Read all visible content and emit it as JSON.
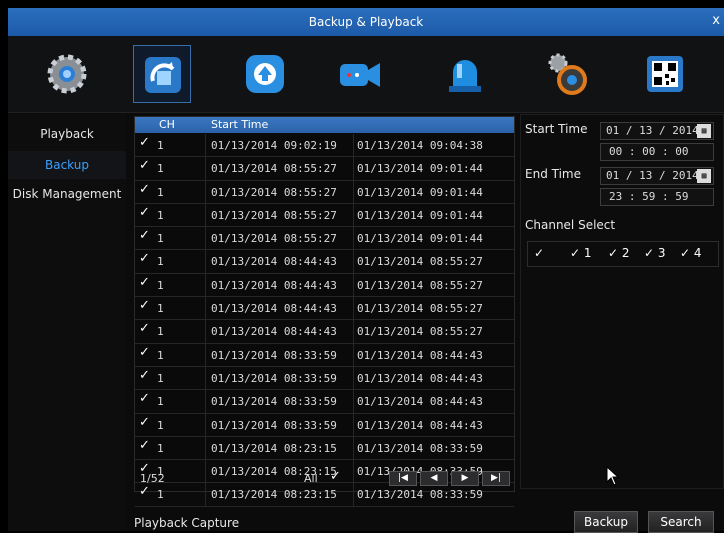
{
  "window": {
    "title": "Backup & Playback",
    "close_glyph": "x"
  },
  "toolbar": {
    "items": [
      {
        "icon": "gear-icon"
      },
      {
        "icon": "backup-icon"
      },
      {
        "icon": "upload-icon"
      },
      {
        "icon": "camera-icon"
      },
      {
        "icon": "alarm-icon"
      },
      {
        "icon": "settings-icon"
      },
      {
        "icon": "qr-code-icon"
      }
    ]
  },
  "nav": {
    "items": [
      {
        "label": "Playback"
      },
      {
        "label": "Backup"
      },
      {
        "label": "Disk Management"
      }
    ]
  },
  "table": {
    "headers": {
      "ch": "CH",
      "start": "Start Time",
      "end": ""
    },
    "rows": [
      {
        "ch": "1",
        "start": "01/13/2014 09:02:19",
        "end": "01/13/2014 09:04:38"
      },
      {
        "ch": "1",
        "start": "01/13/2014 08:55:27",
        "end": "01/13/2014 09:01:44"
      },
      {
        "ch": "1",
        "start": "01/13/2014 08:55:27",
        "end": "01/13/2014 09:01:44"
      },
      {
        "ch": "1",
        "start": "01/13/2014 08:55:27",
        "end": "01/13/2014 09:01:44"
      },
      {
        "ch": "1",
        "start": "01/13/2014 08:55:27",
        "end": "01/13/2014 09:01:44"
      },
      {
        "ch": "1",
        "start": "01/13/2014 08:44:43",
        "end": "01/13/2014 08:55:27"
      },
      {
        "ch": "1",
        "start": "01/13/2014 08:44:43",
        "end": "01/13/2014 08:55:27"
      },
      {
        "ch": "1",
        "start": "01/13/2014 08:44:43",
        "end": "01/13/2014 08:55:27"
      },
      {
        "ch": "1",
        "start": "01/13/2014 08:44:43",
        "end": "01/13/2014 08:55:27"
      },
      {
        "ch": "1",
        "start": "01/13/2014 08:33:59",
        "end": "01/13/2014 08:44:43"
      },
      {
        "ch": "1",
        "start": "01/13/2014 08:33:59",
        "end": "01/13/2014 08:44:43"
      },
      {
        "ch": "1",
        "start": "01/13/2014 08:33:59",
        "end": "01/13/2014 08:44:43"
      },
      {
        "ch": "1",
        "start": "01/13/2014 08:33:59",
        "end": "01/13/2014 08:44:43"
      },
      {
        "ch": "1",
        "start": "01/13/2014 08:23:15",
        "end": "01/13/2014 08:33:59"
      },
      {
        "ch": "1",
        "start": "01/13/2014 08:23:15",
        "end": "01/13/2014 08:33:59"
      },
      {
        "ch": "1",
        "start": "01/13/2014 08:23:15",
        "end": "01/13/2014 08:33:59"
      }
    ],
    "check_glyph": "✓"
  },
  "pager": {
    "page": "1/52",
    "all_label": "All",
    "first": "|◀",
    "prev": "◀",
    "next": "▶",
    "last": "▶|"
  },
  "filter": {
    "start_label": "Start Time",
    "start_date": "01 / 13 / 2014",
    "start_time": "00 : 00 : 00",
    "end_label": "End Time",
    "end_date": "01 / 13 / 2014",
    "end_time": "23 : 59 : 59",
    "channel_label": "Channel Select",
    "channels": [
      "",
      "1",
      "2",
      "3",
      "4"
    ]
  },
  "footer": {
    "capture_label": "Playback Capture",
    "backup_button": "Backup",
    "search_button": "Search"
  },
  "colors": {
    "title_bar": "#2667b5",
    "accent": "#3aa0ff"
  }
}
